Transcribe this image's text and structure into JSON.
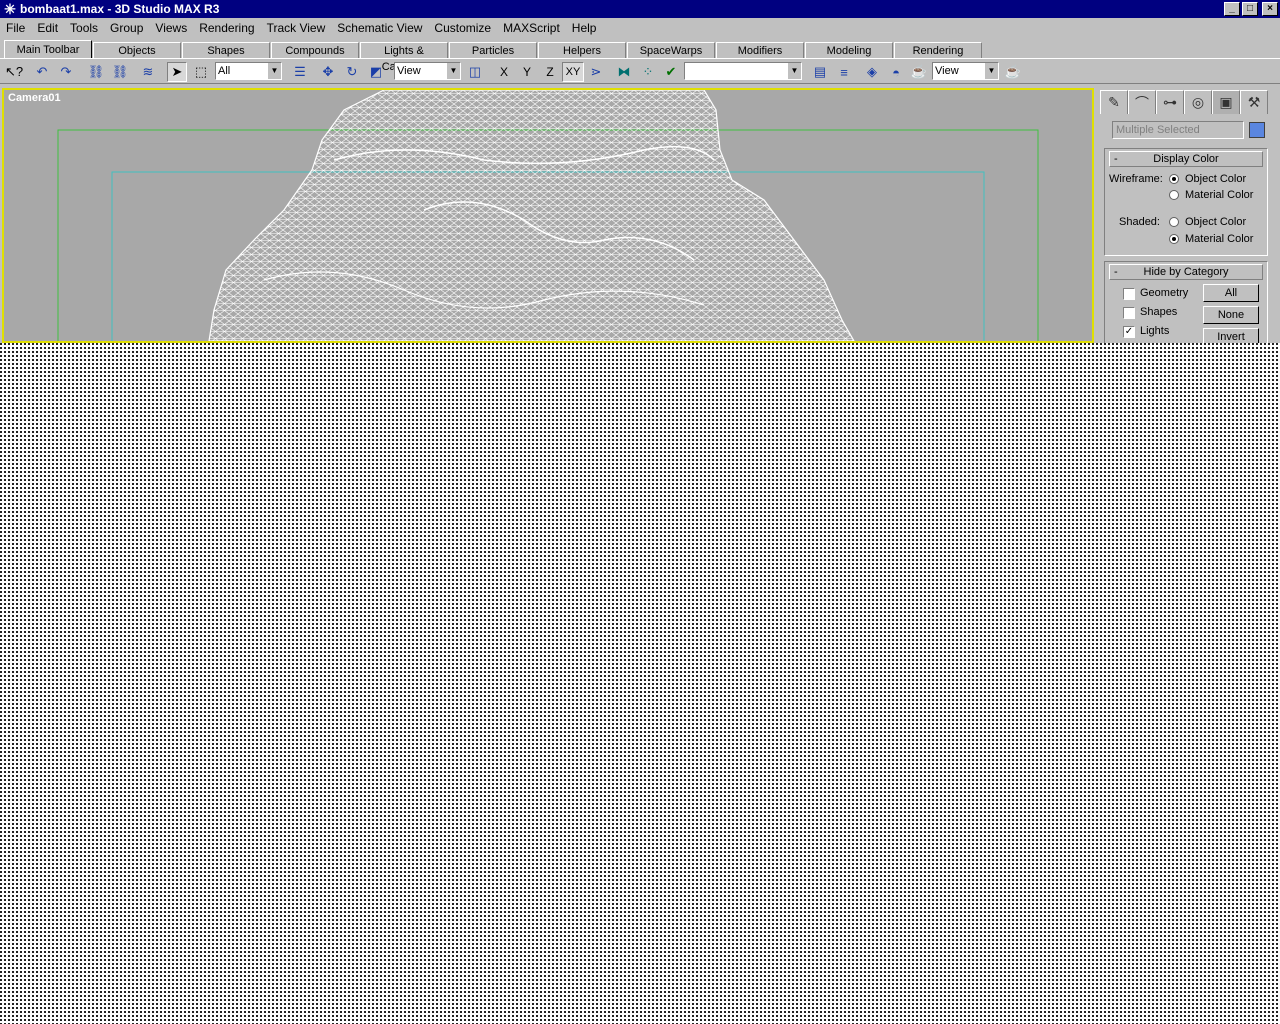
{
  "window": {
    "title": "bombaat1.max - 3D Studio MAX R3",
    "app_icon": "3dsmax-star-icon",
    "buttons": {
      "minimize": "_",
      "maximize": "□",
      "close": "×"
    }
  },
  "menubar": {
    "items": [
      {
        "label": "File"
      },
      {
        "label": "Edit"
      },
      {
        "label": "Tools"
      },
      {
        "label": "Group"
      },
      {
        "label": "Views"
      },
      {
        "label": "Rendering"
      },
      {
        "label": "Track View"
      },
      {
        "label": "Schematic View"
      },
      {
        "label": "Customize"
      },
      {
        "label": "MAXScript"
      },
      {
        "label": "Help"
      }
    ]
  },
  "tabs": {
    "items": [
      {
        "label": "Main Toolbar",
        "active": true
      },
      {
        "label": "Objects"
      },
      {
        "label": "Shapes"
      },
      {
        "label": "Compounds"
      },
      {
        "label": "Lights & Cameras"
      },
      {
        "label": "Particles"
      },
      {
        "label": "Helpers"
      },
      {
        "label": "SpaceWarps"
      },
      {
        "label": "Modifiers"
      },
      {
        "label": "Modeling"
      },
      {
        "label": "Rendering"
      }
    ]
  },
  "toolbar": {
    "selection_filter": "All",
    "ref_coord_1": "View",
    "axis_x": "X",
    "axis_y": "Y",
    "axis_z": "Z",
    "axis_xy": "XY",
    "named_selection": "",
    "render_view": "View"
  },
  "viewport": {
    "label": "Camera01",
    "border_color": "#e0e000",
    "background_color": "#a8a8a8"
  },
  "command_panel": {
    "selection_name": "Multiple Selected",
    "swatch_color": "#5a86e0",
    "display_color": {
      "title": "Display Color",
      "wireframe_label": "Wireframe:",
      "shaded_label": "Shaded:",
      "object_color": "Object Color",
      "material_color": "Material Color",
      "wireframe_selected": "Object Color",
      "shaded_selected": "Material Color"
    },
    "hide_by_category": {
      "title": "Hide by Category",
      "geometry": "Geometry",
      "shapes": "Shapes",
      "lights": "Lights",
      "lights_checked": true,
      "all_button": "All",
      "none_button": "None",
      "invert_button": "Invert"
    }
  }
}
